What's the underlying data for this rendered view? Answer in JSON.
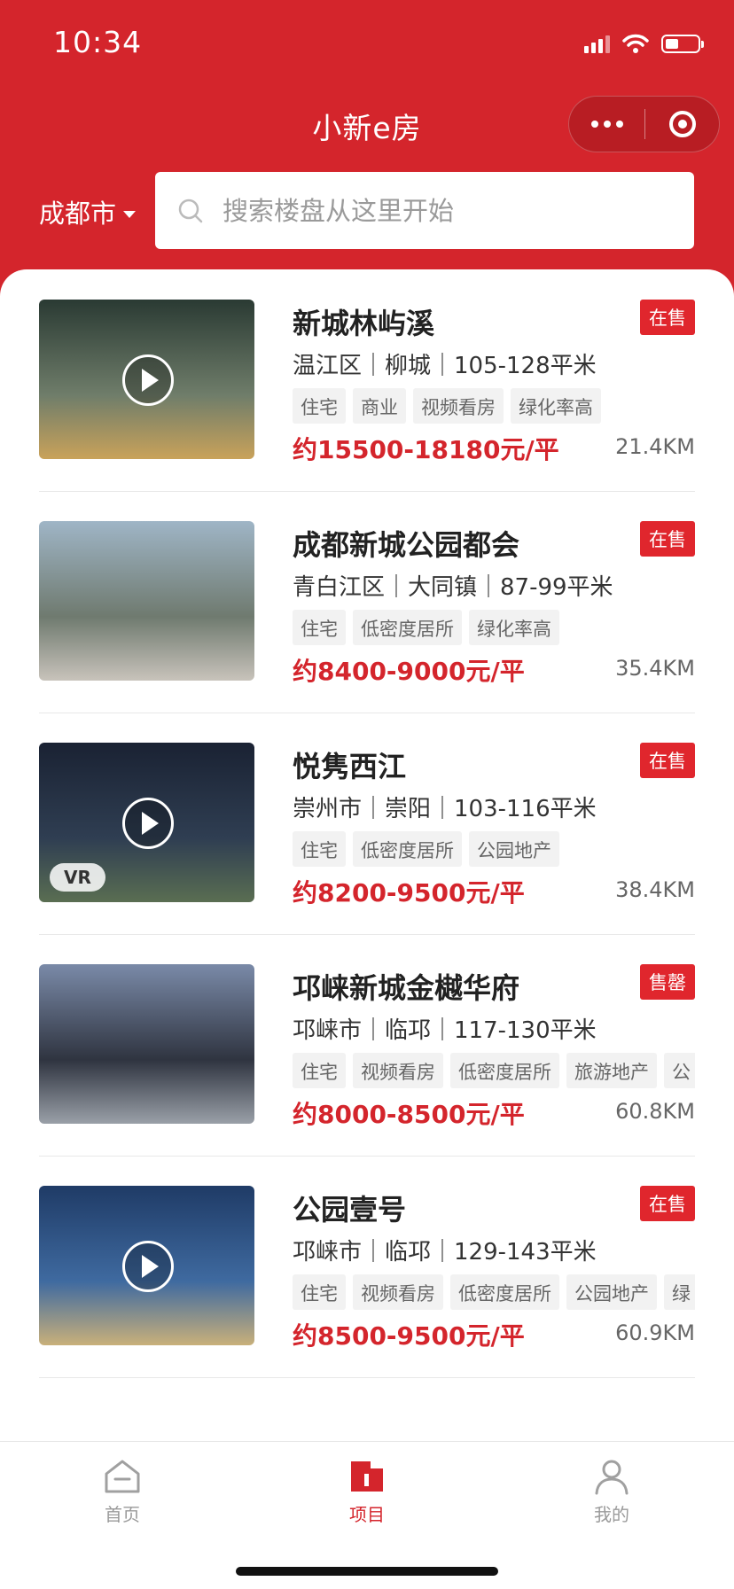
{
  "status_bar": {
    "time": "10:34"
  },
  "nav": {
    "title": "小新e房"
  },
  "city": "成都市",
  "search": {
    "placeholder": "搜索楼盘从这里开始",
    "value": ""
  },
  "listings": [
    {
      "name": "新城林屿溪",
      "status": "在售",
      "meta": "温江区｜柳城｜105-128平米",
      "tags": [
        "住宅",
        "商业",
        "视频看房",
        "绿化率高"
      ],
      "price": "约15500-18180元/平",
      "distance": "21.4KM",
      "has_video": true,
      "vr_label": "",
      "thumb_colors": [
        "#2a3a33",
        "#6f7d6a",
        "#c9a25a"
      ]
    },
    {
      "name": "成都新城公园都会",
      "status": "在售",
      "meta": "青白江区｜大同镇｜87-99平米",
      "tags": [
        "住宅",
        "低密度居所",
        "绿化率高"
      ],
      "price": "约8400-9000元/平",
      "distance": "35.4KM",
      "has_video": false,
      "vr_label": "",
      "thumb_colors": [
        "#9fb5c6",
        "#6f7a6f",
        "#c8c3bb"
      ]
    },
    {
      "name": "悦隽西江",
      "status": "在售",
      "meta": "崇州市｜崇阳｜103-116平米",
      "tags": [
        "住宅",
        "低密度居所",
        "公园地产"
      ],
      "price": "约8200-9500元/平",
      "distance": "38.4KM",
      "has_video": true,
      "vr_label": "VR",
      "thumb_colors": [
        "#1a2233",
        "#2f3e52",
        "#5a6e52"
      ]
    },
    {
      "name": "邛崃新城金樾华府",
      "status": "售罄",
      "meta": "邛崃市｜临邛｜117-130平米",
      "tags": [
        "住宅",
        "视频看房",
        "低密度居所",
        "旅游地产",
        "公"
      ],
      "price": "约8000-8500元/平",
      "distance": "60.8KM",
      "has_video": false,
      "vr_label": "",
      "thumb_colors": [
        "#7a8aa8",
        "#2f3440",
        "#9aa0a8"
      ]
    },
    {
      "name": "公园壹号",
      "status": "在售",
      "meta": "邛崃市｜临邛｜129-143平米",
      "tags": [
        "住宅",
        "视频看房",
        "低密度居所",
        "公园地产",
        "绿"
      ],
      "price": "约8500-9500元/平",
      "distance": "60.9KM",
      "has_video": true,
      "vr_label": "",
      "thumb_colors": [
        "#1f3b66",
        "#3f6aa0",
        "#c9b07a"
      ]
    }
  ],
  "tabbar": {
    "tabs": [
      {
        "label": "首页",
        "icon": "home-icon",
        "active": false
      },
      {
        "label": "项目",
        "icon": "project-icon",
        "active": true
      },
      {
        "label": "我的",
        "icon": "user-icon",
        "active": false
      }
    ]
  },
  "colors": {
    "brand": "#d4252c",
    "badge": "#e0262d"
  }
}
